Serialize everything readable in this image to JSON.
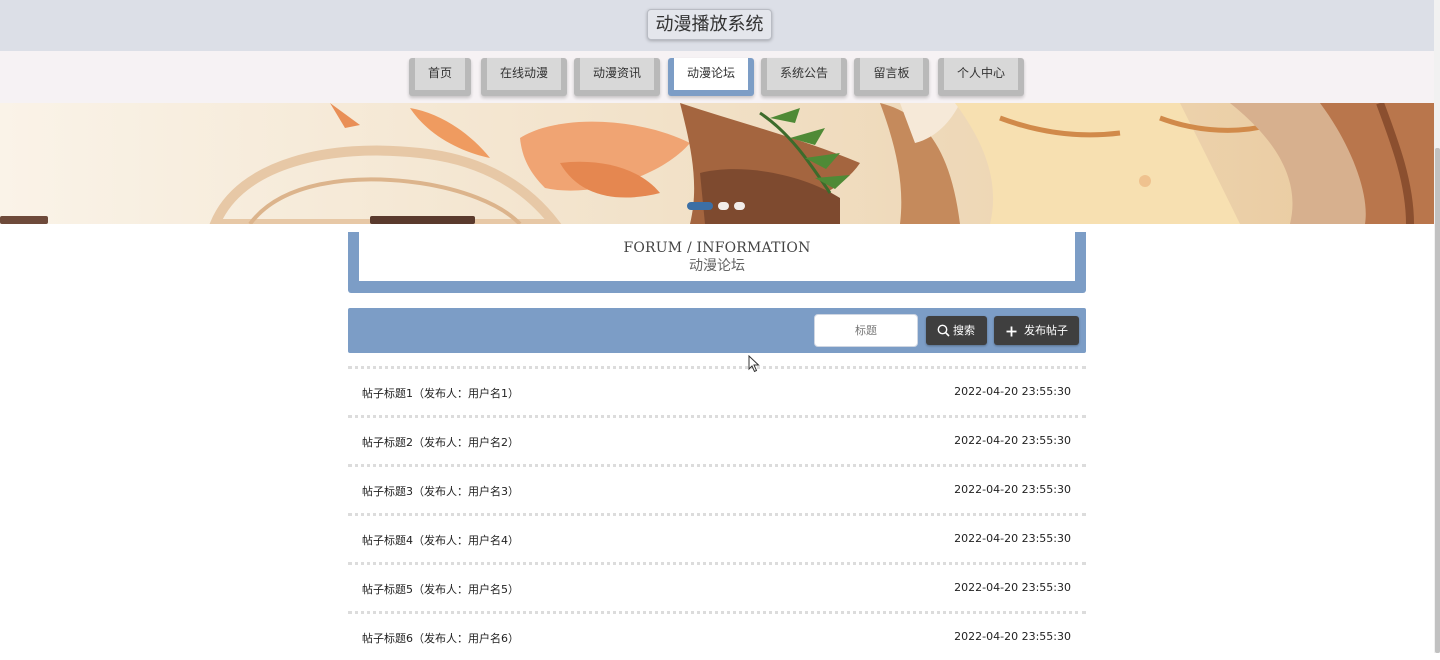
{
  "header": {
    "site_title": "动漫播放系统"
  },
  "nav": {
    "items": [
      {
        "label": "首页"
      },
      {
        "label": "在线动漫"
      },
      {
        "label": "动漫资讯"
      },
      {
        "label": "动漫论坛",
        "active": true
      },
      {
        "label": "系统公告"
      },
      {
        "label": "留言板"
      },
      {
        "label": "个人中心"
      }
    ]
  },
  "banner": {
    "slide_count": 3,
    "active_slide": 1
  },
  "section": {
    "title_en": "FORUM / INFORMATION",
    "title_cn": "动漫论坛"
  },
  "search": {
    "placeholder": "标题",
    "value": "",
    "search_label": "搜索",
    "post_label": "发布帖子"
  },
  "posts": [
    {
      "title": "帖子标题1（发布人：用户名1）",
      "time": "2022-04-20 23:55:30"
    },
    {
      "title": "帖子标题2（发布人：用户名2）",
      "time": "2022-04-20 23:55:30"
    },
    {
      "title": "帖子标题3（发布人：用户名3）",
      "time": "2022-04-20 23:55:30"
    },
    {
      "title": "帖子标题4（发布人：用户名4）",
      "time": "2022-04-20 23:55:30"
    },
    {
      "title": "帖子标题5（发布人：用户名5）",
      "time": "2022-04-20 23:55:30"
    },
    {
      "title": "帖子标题6（发布人：用户名6）",
      "time": "2022-04-20 23:55:30"
    }
  ],
  "colors": {
    "accent": "#7c9dc6",
    "button_dark": "#3f3f3f",
    "header_bg": "#dcdfe7"
  },
  "icons": {
    "search": "magnifier-icon",
    "post": "plus-icon"
  }
}
